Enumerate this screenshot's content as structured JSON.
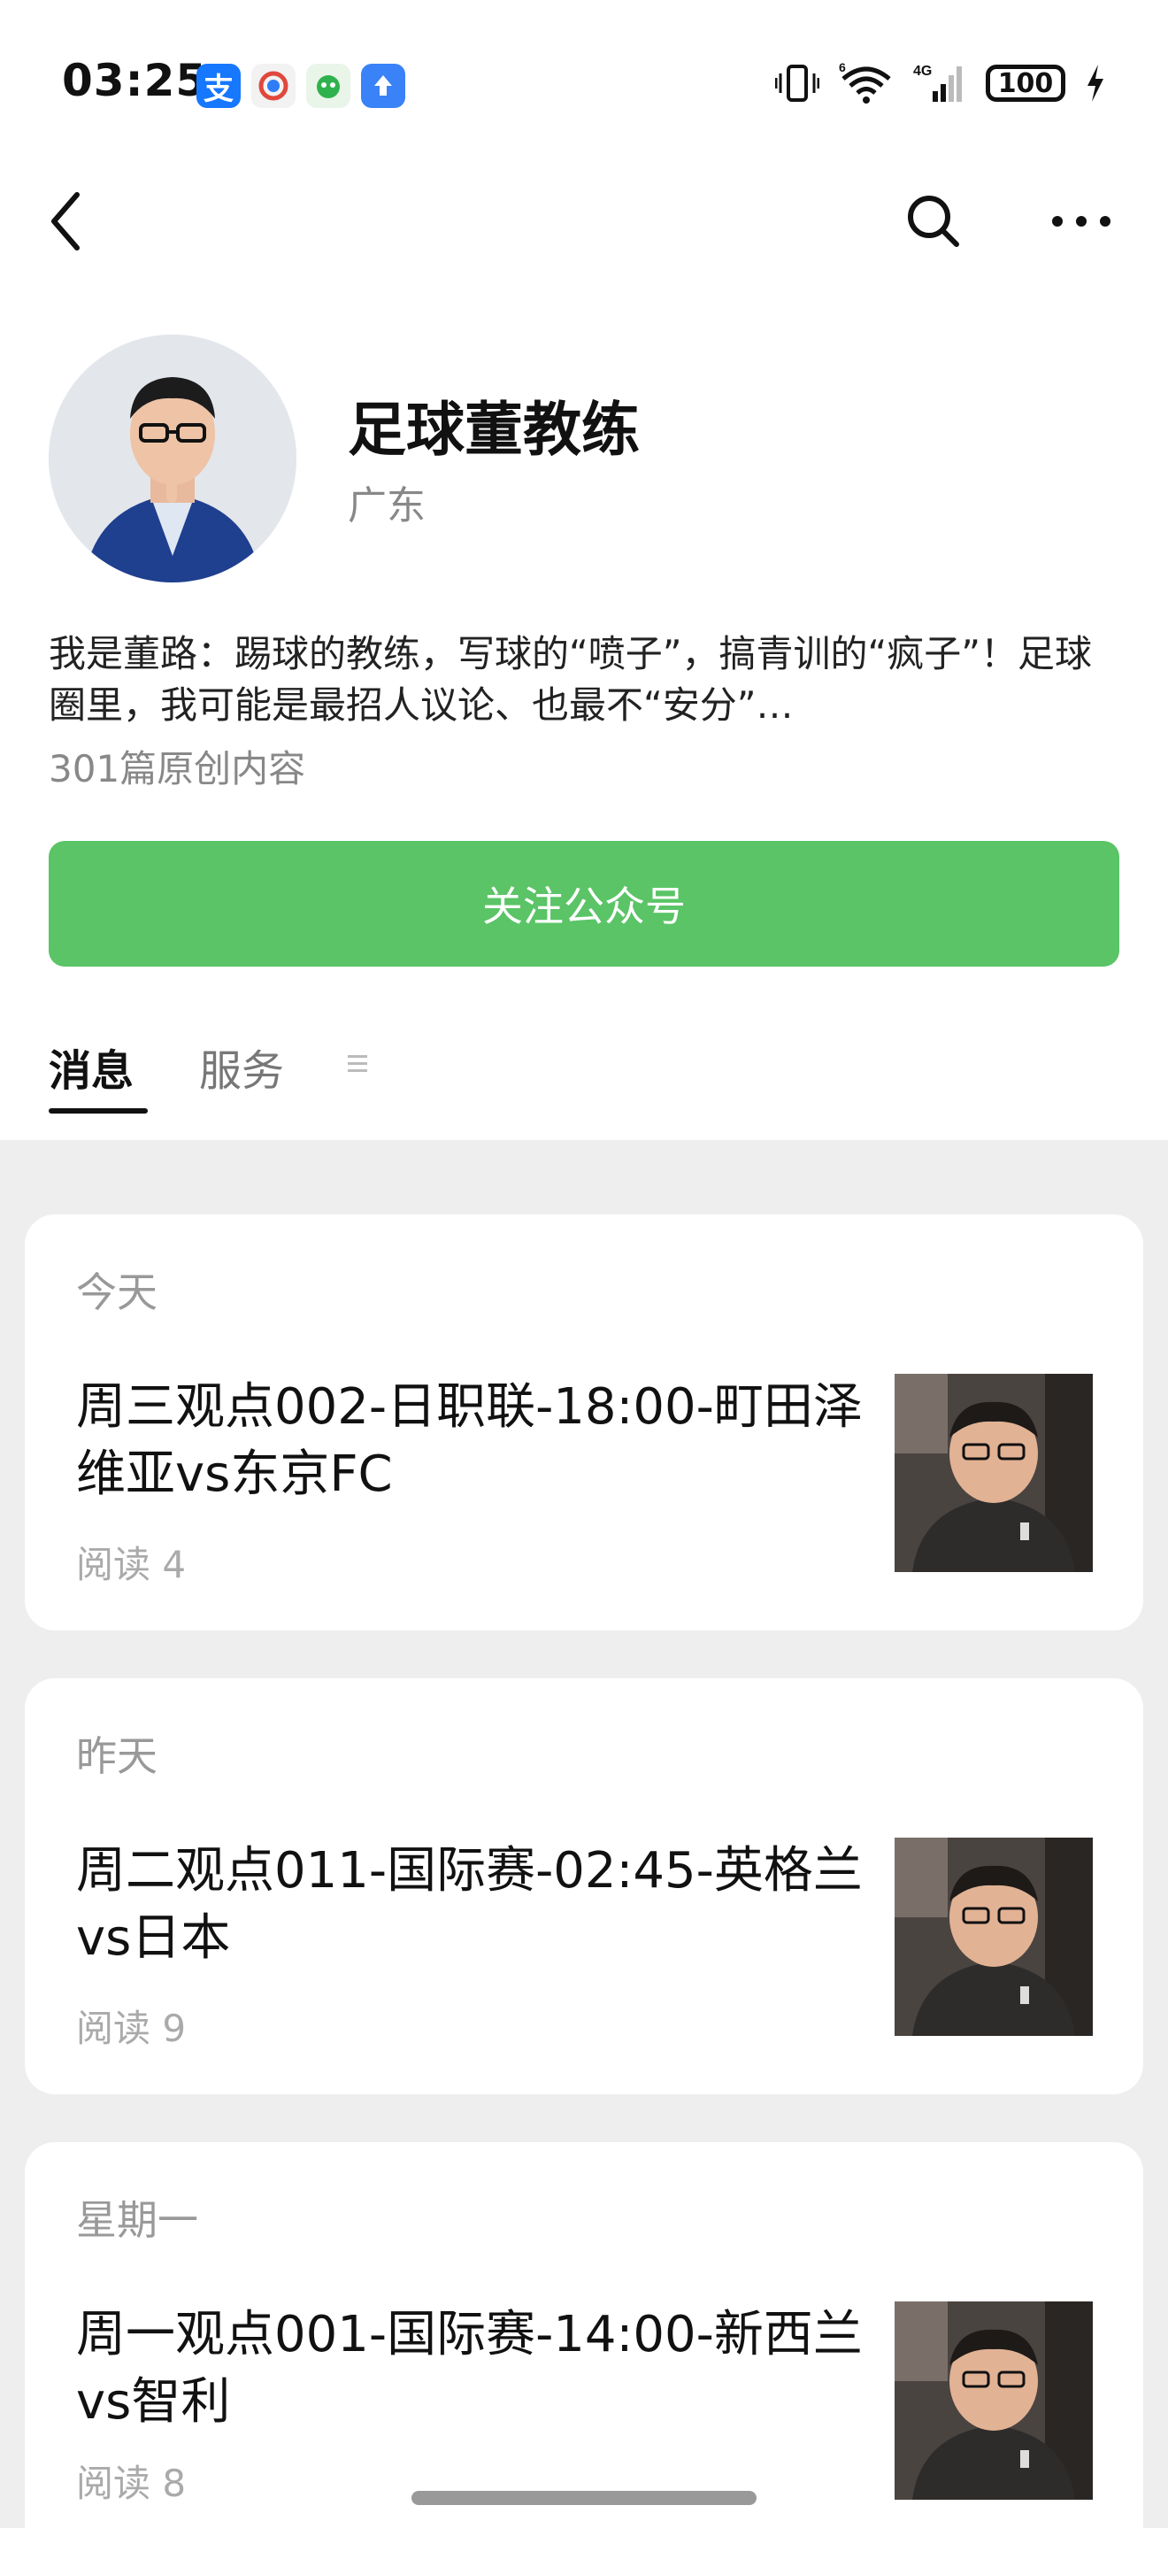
{
  "status_bar": {
    "time": "03:25",
    "app_icons": [
      "alipay-icon",
      "browser-icon",
      "mascot-app-icon",
      "upload-app-icon"
    ],
    "battery": "100",
    "network": "4G",
    "wifi_badge": "6"
  },
  "nav": {
    "back_icon": "chevron-left-icon",
    "search_icon": "search-icon",
    "more_icon": "more-dots-icon"
  },
  "profile": {
    "name": "足球董教练",
    "region": "广东",
    "bio": "我是董路：踢球的教练，写球的“喷子”，搞青训的“疯子”！足球圈里，我可能是最招人议论、也最不“安分”…",
    "article_count": "301篇原创内容",
    "follow_label": "关注公众号"
  },
  "tabs": {
    "messages": "消息",
    "services": "服务"
  },
  "feed": [
    {
      "date": "今天",
      "title": "周三观点002-日职联-18:00-町田泽维亚vs东京FC",
      "reads": "阅读 4"
    },
    {
      "date": "昨天",
      "title": "周二观点011-国际赛-02:45-英格兰vs日本",
      "reads": "阅读 9"
    },
    {
      "date": "星期一",
      "title": "周一观点001-国际赛-14:00-新西兰vs智利",
      "reads": "阅读 8"
    }
  ],
  "colors": {
    "accent_green": "#5ac466",
    "feed_background": "#eeeeee",
    "card_background": "#ffffff"
  }
}
